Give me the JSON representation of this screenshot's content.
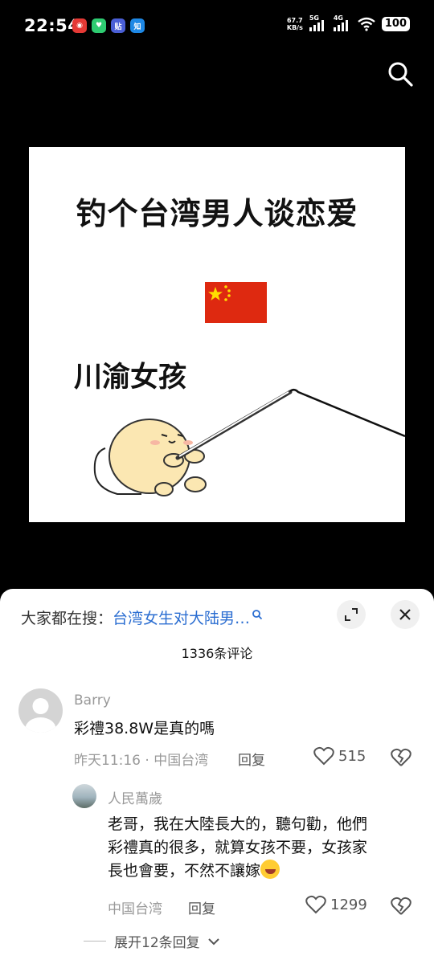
{
  "status_bar": {
    "time": "22:54",
    "net_speed_value": "67.7",
    "net_speed_unit": "KB/s",
    "sim1": "5G",
    "sim2": "4G",
    "battery": "100"
  },
  "meme": {
    "title": "钓个台湾男人谈恋爱",
    "subtitle": "川渝女孩"
  },
  "comments_sheet": {
    "hot_search_label": "大家都在搜：",
    "hot_search_query": "台湾女生对大陆男…",
    "comment_count": "1336条评论",
    "comments": [
      {
        "username": "Barry",
        "text": "彩禮38.8W是真的嗎",
        "time": "昨天11:16",
        "location": "中国台湾",
        "reply_label": "回复",
        "likes": "515"
      },
      {
        "username": "人民萬歲",
        "text_lines": [
          "老哥，我在大陸長大的，聽句勸，他們",
          "彩禮真的很多，就算女孩不要，女孩家",
          "長也會要，不然不讓嫁"
        ],
        "location": "中国台湾",
        "reply_label": "回复",
        "likes": "1299"
      }
    ],
    "expand_replies": "展开12条回复"
  },
  "colors": {
    "accent_link": "#2a6dd1",
    "flag_red": "#de2910"
  },
  "icons": [
    "search-icon",
    "expand-icon",
    "close-icon",
    "heart-icon",
    "broken-heart-icon",
    "chevron-down-icon",
    "laughing-crying-emoji"
  ]
}
